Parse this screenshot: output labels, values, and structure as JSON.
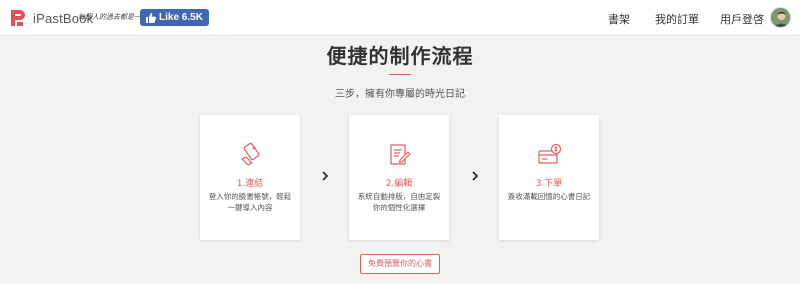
{
  "header": {
    "logo_text": "iPastBook",
    "tagline": "每個人的過去都是一本書",
    "fb_like_label": "Like 6.5K",
    "nav": {
      "bookshelf": "書架",
      "orders": "我的訂單",
      "login": "用戶登啓"
    }
  },
  "section": {
    "title": "便捷的制作流程",
    "subtitle": "三步，擁有你專屬的時光日記"
  },
  "steps": [
    {
      "title": "1.連結",
      "description": "登入你的臉書帳號，輕鬆一鍵導入內容",
      "icon": "phone-link-icon"
    },
    {
      "title": "2.編輯",
      "description": "系統自動排版，自由定製你的個性化選擇",
      "icon": "edit-document-icon"
    },
    {
      "title": "3.下單",
      "description": "簽收滿載回憶的心書日記",
      "icon": "payment-card-icon"
    }
  ],
  "cta": {
    "label": "免費預覽你的心書"
  },
  "colors": {
    "accent": "#e06060",
    "facebook": "#4267b2",
    "background": "#f2f2f2"
  }
}
